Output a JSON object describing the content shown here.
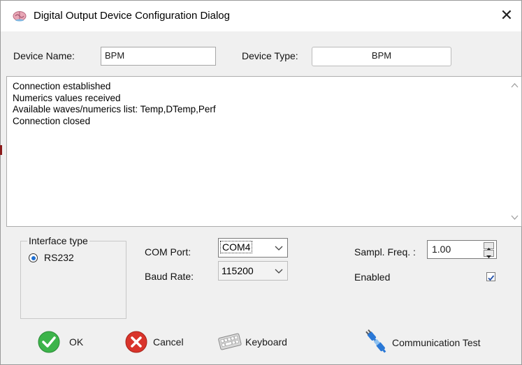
{
  "window": {
    "title": "Digital Output Device Configuration Dialog"
  },
  "device": {
    "name_label": "Device Name:",
    "name_value": "BPM",
    "type_label": "Device Type:",
    "type_value": "BPM"
  },
  "log": {
    "lines": [
      "Connection established",
      "Numerics values received",
      "Available waves/numerics list: Temp,DTemp,Perf",
      "Connection closed"
    ]
  },
  "interface": {
    "legend": "Interface type",
    "option_label": "RS232",
    "selected": true
  },
  "serial": {
    "com_label": "COM Port:",
    "com_value": "COM4",
    "baud_label": "Baud Rate:",
    "baud_value": "115200"
  },
  "sampling": {
    "label": "Sampl. Freq. :",
    "value": "1.00",
    "enabled_label": "Enabled",
    "enabled": true
  },
  "buttons": {
    "ok": "OK",
    "cancel": "Cancel",
    "keyboard": "Keyboard",
    "comm_test": "Communication Test"
  },
  "icons": {
    "app": "brain-icon",
    "close": "close-icon",
    "ok": "check-circle-icon",
    "cancel": "x-circle-icon",
    "keyboard": "keyboard-icon",
    "comm_test": "plug-connector-icon"
  },
  "colors": {
    "ok_green": "#3cb44a",
    "cancel_red": "#d9342b",
    "radio_blue": "#1f6fd1",
    "plug_blue": "#2a78d6"
  }
}
